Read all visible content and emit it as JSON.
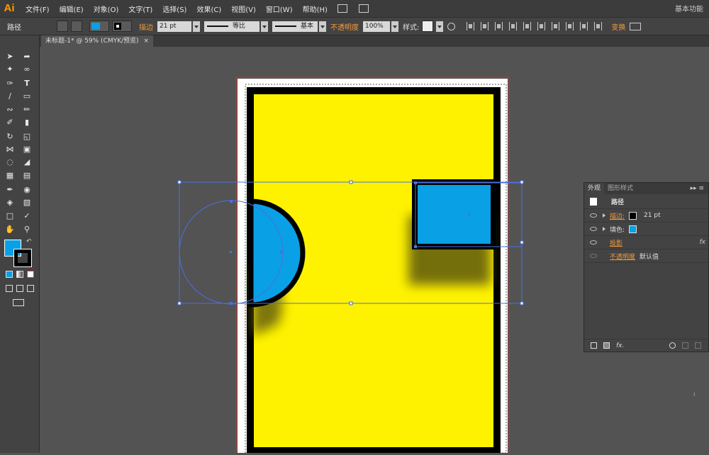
{
  "app": {
    "logo": "Ai",
    "workspace": "基本功能"
  },
  "menu": [
    "文件(F)",
    "编辑(E)",
    "对象(O)",
    "文字(T)",
    "选择(S)",
    "效果(C)",
    "视图(V)",
    "窗口(W)",
    "帮助(H)"
  ],
  "control": {
    "selection_label": "路径",
    "fill_color": "#0aa0e5",
    "stroke_label": "描边",
    "stroke_weight": "21 pt",
    "profile": "等比",
    "brush": "基本",
    "opacity_label": "不透明度",
    "opacity_value": "100%",
    "style_label": "样式:",
    "transform_label": "变换"
  },
  "document": {
    "tab_title": "未标题-1* @ 59% (CMYK/预览)",
    "close": "×"
  },
  "artwork": {
    "background_color": "#fff200",
    "shape_color": "#0aa0e5",
    "selection_color": "#4a6fe0"
  },
  "appearance_panel": {
    "tabs": [
      "外观",
      "图形样式"
    ],
    "title": "路径",
    "rows": [
      {
        "label": "描边:",
        "value": "21 pt",
        "swatch": "#000000"
      },
      {
        "label": "填色:",
        "swatch": "#0aa0e5"
      },
      {
        "label": "投影",
        "fx": "fx"
      },
      {
        "label": "不透明度",
        "value": "默认值"
      }
    ],
    "footer_fx": "fx."
  }
}
